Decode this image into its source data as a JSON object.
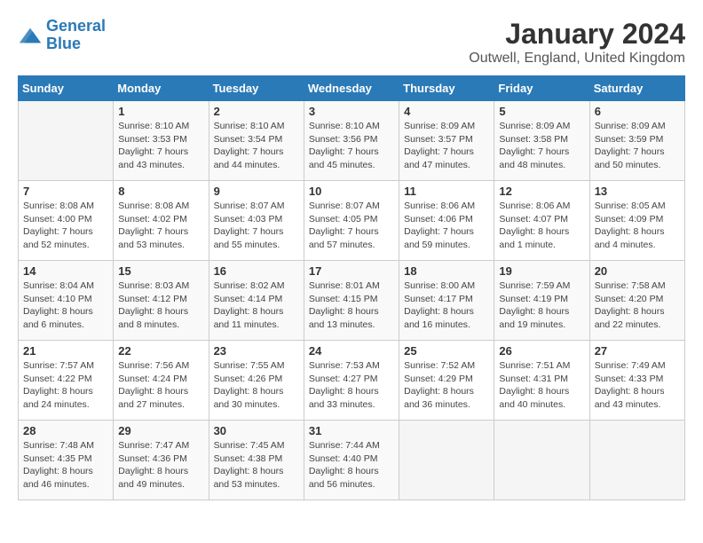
{
  "header": {
    "logo_line1": "General",
    "logo_line2": "Blue",
    "month_title": "January 2024",
    "location": "Outwell, England, United Kingdom"
  },
  "days_of_week": [
    "Sunday",
    "Monday",
    "Tuesday",
    "Wednesday",
    "Thursday",
    "Friday",
    "Saturday"
  ],
  "weeks": [
    [
      {
        "day": "",
        "sunrise": "",
        "sunset": "",
        "daylight": ""
      },
      {
        "day": "1",
        "sunrise": "Sunrise: 8:10 AM",
        "sunset": "Sunset: 3:53 PM",
        "daylight": "Daylight: 7 hours and 43 minutes."
      },
      {
        "day": "2",
        "sunrise": "Sunrise: 8:10 AM",
        "sunset": "Sunset: 3:54 PM",
        "daylight": "Daylight: 7 hours and 44 minutes."
      },
      {
        "day": "3",
        "sunrise": "Sunrise: 8:10 AM",
        "sunset": "Sunset: 3:56 PM",
        "daylight": "Daylight: 7 hours and 45 minutes."
      },
      {
        "day": "4",
        "sunrise": "Sunrise: 8:09 AM",
        "sunset": "Sunset: 3:57 PM",
        "daylight": "Daylight: 7 hours and 47 minutes."
      },
      {
        "day": "5",
        "sunrise": "Sunrise: 8:09 AM",
        "sunset": "Sunset: 3:58 PM",
        "daylight": "Daylight: 7 hours and 48 minutes."
      },
      {
        "day": "6",
        "sunrise": "Sunrise: 8:09 AM",
        "sunset": "Sunset: 3:59 PM",
        "daylight": "Daylight: 7 hours and 50 minutes."
      }
    ],
    [
      {
        "day": "7",
        "sunrise": "Sunrise: 8:08 AM",
        "sunset": "Sunset: 4:00 PM",
        "daylight": "Daylight: 7 hours and 52 minutes."
      },
      {
        "day": "8",
        "sunrise": "Sunrise: 8:08 AM",
        "sunset": "Sunset: 4:02 PM",
        "daylight": "Daylight: 7 hours and 53 minutes."
      },
      {
        "day": "9",
        "sunrise": "Sunrise: 8:07 AM",
        "sunset": "Sunset: 4:03 PM",
        "daylight": "Daylight: 7 hours and 55 minutes."
      },
      {
        "day": "10",
        "sunrise": "Sunrise: 8:07 AM",
        "sunset": "Sunset: 4:05 PM",
        "daylight": "Daylight: 7 hours and 57 minutes."
      },
      {
        "day": "11",
        "sunrise": "Sunrise: 8:06 AM",
        "sunset": "Sunset: 4:06 PM",
        "daylight": "Daylight: 7 hours and 59 minutes."
      },
      {
        "day": "12",
        "sunrise": "Sunrise: 8:06 AM",
        "sunset": "Sunset: 4:07 PM",
        "daylight": "Daylight: 8 hours and 1 minute."
      },
      {
        "day": "13",
        "sunrise": "Sunrise: 8:05 AM",
        "sunset": "Sunset: 4:09 PM",
        "daylight": "Daylight: 8 hours and 4 minutes."
      }
    ],
    [
      {
        "day": "14",
        "sunrise": "Sunrise: 8:04 AM",
        "sunset": "Sunset: 4:10 PM",
        "daylight": "Daylight: 8 hours and 6 minutes."
      },
      {
        "day": "15",
        "sunrise": "Sunrise: 8:03 AM",
        "sunset": "Sunset: 4:12 PM",
        "daylight": "Daylight: 8 hours and 8 minutes."
      },
      {
        "day": "16",
        "sunrise": "Sunrise: 8:02 AM",
        "sunset": "Sunset: 4:14 PM",
        "daylight": "Daylight: 8 hours and 11 minutes."
      },
      {
        "day": "17",
        "sunrise": "Sunrise: 8:01 AM",
        "sunset": "Sunset: 4:15 PM",
        "daylight": "Daylight: 8 hours and 13 minutes."
      },
      {
        "day": "18",
        "sunrise": "Sunrise: 8:00 AM",
        "sunset": "Sunset: 4:17 PM",
        "daylight": "Daylight: 8 hours and 16 minutes."
      },
      {
        "day": "19",
        "sunrise": "Sunrise: 7:59 AM",
        "sunset": "Sunset: 4:19 PM",
        "daylight": "Daylight: 8 hours and 19 minutes."
      },
      {
        "day": "20",
        "sunrise": "Sunrise: 7:58 AM",
        "sunset": "Sunset: 4:20 PM",
        "daylight": "Daylight: 8 hours and 22 minutes."
      }
    ],
    [
      {
        "day": "21",
        "sunrise": "Sunrise: 7:57 AM",
        "sunset": "Sunset: 4:22 PM",
        "daylight": "Daylight: 8 hours and 24 minutes."
      },
      {
        "day": "22",
        "sunrise": "Sunrise: 7:56 AM",
        "sunset": "Sunset: 4:24 PM",
        "daylight": "Daylight: 8 hours and 27 minutes."
      },
      {
        "day": "23",
        "sunrise": "Sunrise: 7:55 AM",
        "sunset": "Sunset: 4:26 PM",
        "daylight": "Daylight: 8 hours and 30 minutes."
      },
      {
        "day": "24",
        "sunrise": "Sunrise: 7:53 AM",
        "sunset": "Sunset: 4:27 PM",
        "daylight": "Daylight: 8 hours and 33 minutes."
      },
      {
        "day": "25",
        "sunrise": "Sunrise: 7:52 AM",
        "sunset": "Sunset: 4:29 PM",
        "daylight": "Daylight: 8 hours and 36 minutes."
      },
      {
        "day": "26",
        "sunrise": "Sunrise: 7:51 AM",
        "sunset": "Sunset: 4:31 PM",
        "daylight": "Daylight: 8 hours and 40 minutes."
      },
      {
        "day": "27",
        "sunrise": "Sunrise: 7:49 AM",
        "sunset": "Sunset: 4:33 PM",
        "daylight": "Daylight: 8 hours and 43 minutes."
      }
    ],
    [
      {
        "day": "28",
        "sunrise": "Sunrise: 7:48 AM",
        "sunset": "Sunset: 4:35 PM",
        "daylight": "Daylight: 8 hours and 46 minutes."
      },
      {
        "day": "29",
        "sunrise": "Sunrise: 7:47 AM",
        "sunset": "Sunset: 4:36 PM",
        "daylight": "Daylight: 8 hours and 49 minutes."
      },
      {
        "day": "30",
        "sunrise": "Sunrise: 7:45 AM",
        "sunset": "Sunset: 4:38 PM",
        "daylight": "Daylight: 8 hours and 53 minutes."
      },
      {
        "day": "31",
        "sunrise": "Sunrise: 7:44 AM",
        "sunset": "Sunset: 4:40 PM",
        "daylight": "Daylight: 8 hours and 56 minutes."
      },
      {
        "day": "",
        "sunrise": "",
        "sunset": "",
        "daylight": ""
      },
      {
        "day": "",
        "sunrise": "",
        "sunset": "",
        "daylight": ""
      },
      {
        "day": "",
        "sunrise": "",
        "sunset": "",
        "daylight": ""
      }
    ]
  ]
}
